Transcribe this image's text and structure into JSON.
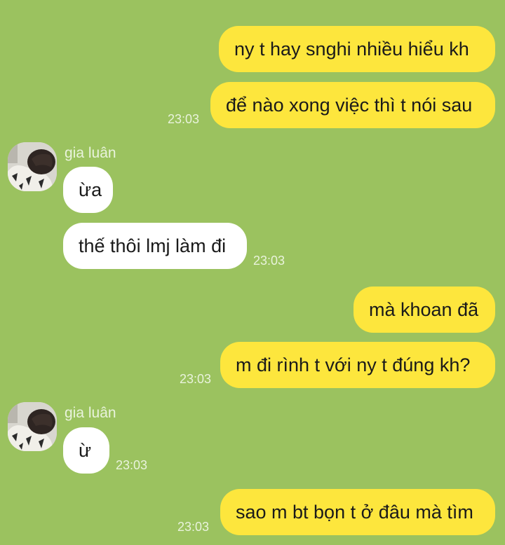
{
  "conversation": {
    "messages": [
      {
        "direction": "out",
        "text": "ny t hay snghi nhiều hiểu kh"
      },
      {
        "direction": "out",
        "text": "để nào xong việc thì t nói sau",
        "time": "23:03"
      },
      {
        "direction": "in",
        "sender": "gia luân",
        "text": "ừa"
      },
      {
        "direction": "in",
        "text": "thế thôi lmj làm đi",
        "time": "23:03"
      },
      {
        "direction": "out",
        "text": "mà khoan đã"
      },
      {
        "direction": "out",
        "text": "m đi rình t với ny t đúng kh?",
        "time": "23:03"
      },
      {
        "direction": "in",
        "sender": "gia luân",
        "text": "ừ",
        "time": "23:03"
      },
      {
        "direction": "out",
        "text": "sao m bt bọn t ở đâu mà tìm",
        "time": "23:03"
      }
    ]
  },
  "colors": {
    "chat_background": "#9bc25f",
    "outgoing_bubble": "#fde63d",
    "incoming_bubble": "#ffffff",
    "meta_text": "#e9f3dc"
  },
  "icons": {
    "avatar": "user-avatar-photo"
  }
}
